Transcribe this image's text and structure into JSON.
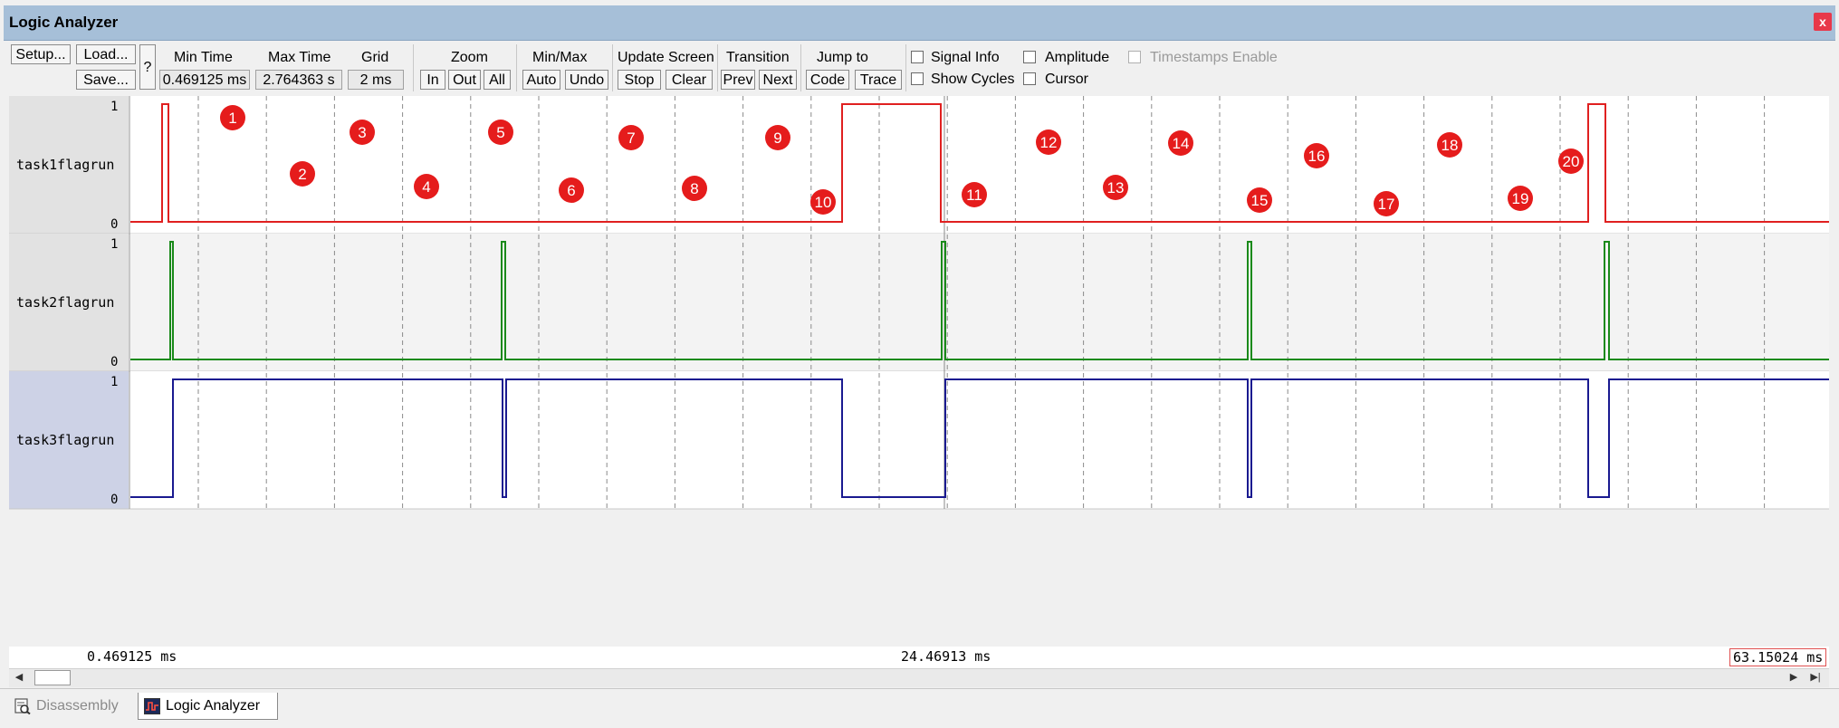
{
  "window": {
    "title": "Logic Analyzer",
    "close_glyph": "x"
  },
  "toolbar": {
    "setup": "Setup...",
    "load": "Load...",
    "save": "Save...",
    "help": "?",
    "min_time_caption": "Min Time",
    "min_time_value": "0.469125 ms",
    "max_time_caption": "Max Time",
    "max_time_value": "2.764363 s",
    "grid_caption": "Grid",
    "grid_value": "2 ms",
    "zoom_caption": "Zoom",
    "zoom_in": "In",
    "zoom_out": "Out",
    "zoom_all": "All",
    "minmax_caption": "Min/Max",
    "minmax_auto": "Auto",
    "minmax_undo": "Undo",
    "update_caption": "Update Screen",
    "update_stop": "Stop",
    "update_clear": "Clear",
    "transition_caption": "Transition",
    "transition_prev": "Prev",
    "transition_next": "Next",
    "jump_caption": "Jump to",
    "jump_code": "Code",
    "jump_trace": "Trace",
    "signal_info": "Signal Info",
    "show_cycles": "Show Cycles",
    "amplitude": "Amplitude",
    "cursor": "Cursor",
    "timestamps_enable": "Timestamps Enable"
  },
  "signals": [
    {
      "name": "task1flagrun",
      "color": "#e02020",
      "high_label": "1",
      "low_label": "0"
    },
    {
      "name": "task2flagrun",
      "color": "#1a8a1a",
      "high_label": "1",
      "low_label": "0"
    },
    {
      "name": "task3flagrun",
      "color": "#1a1a90",
      "high_label": "1",
      "low_label": "0"
    }
  ],
  "markers": [
    "1",
    "2",
    "3",
    "4",
    "5",
    "6",
    "7",
    "8",
    "9",
    "10",
    "11",
    "12",
    "13",
    "14",
    "15",
    "16",
    "17",
    "18",
    "19",
    "20"
  ],
  "marker_color": "#e51c1c",
  "time_axis": {
    "min": "0.469125 ms",
    "mid": "24.46913 ms",
    "max": "63.15024 ms"
  },
  "tabs": {
    "disassembly": "Disassembly",
    "logic_analyzer": "Logic Analyzer"
  }
}
